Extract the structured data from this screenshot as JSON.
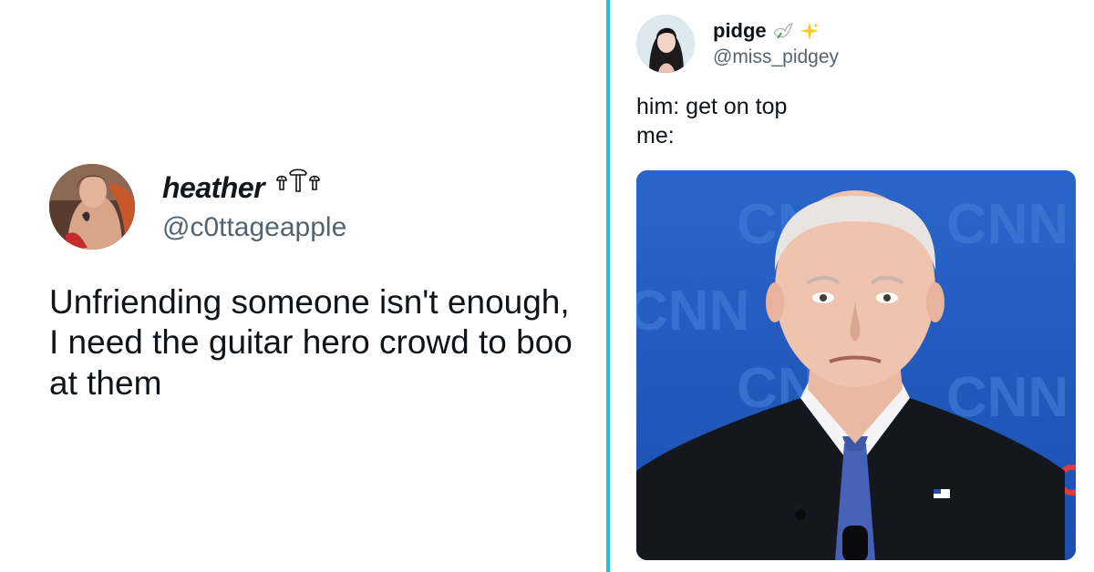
{
  "left_tweet": {
    "display_name": "heather",
    "handle": "@c0ttageapple",
    "text": "Unfriending someone isn't enough, I need the guitar hero crowd to boo at them",
    "name_emoji_icons": [
      "mushroom-icon",
      "mushroom-icon",
      "mushroom-icon"
    ]
  },
  "right_tweet": {
    "display_name": "pidge",
    "handle": "@miss_pidgey",
    "name_emoji_icons": [
      "dove-icon",
      "sparkles-icon"
    ],
    "text_line1": "him: get on top",
    "text_line2": "me:",
    "media": {
      "background_logo_text": "CNN",
      "description_icon": "photo-icon"
    }
  },
  "colors": {
    "divider": "#22c3d9",
    "text_primary": "#0f1419",
    "text_secondary": "#536471",
    "media_blue": "#1b56b8"
  }
}
